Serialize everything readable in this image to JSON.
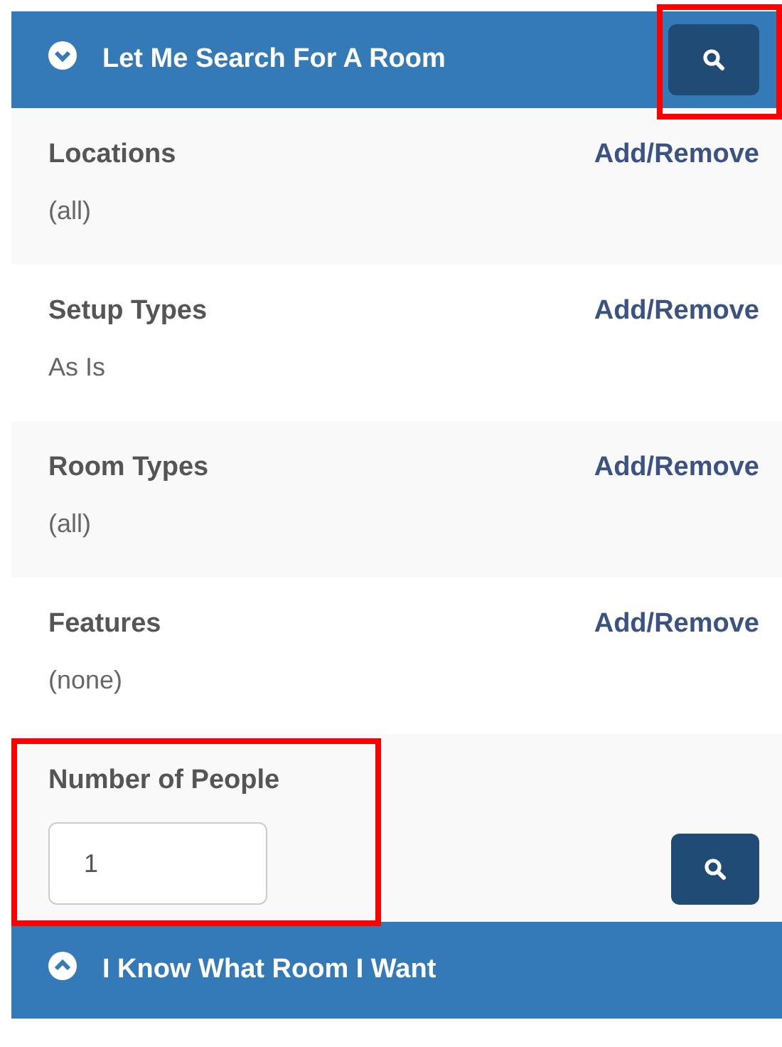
{
  "search_panel": {
    "title": "Let Me Search For A Room",
    "expanded": true,
    "search_button": {
      "highlighted": true
    }
  },
  "filters": [
    {
      "label": "Locations",
      "action": "Add/Remove",
      "value": "(all)"
    },
    {
      "label": "Setup Types",
      "action": "Add/Remove",
      "value": "As Is"
    },
    {
      "label": "Room Types",
      "action": "Add/Remove",
      "value": "(all)"
    },
    {
      "label": "Features",
      "action": "Add/Remove",
      "value": "(none)"
    }
  ],
  "people": {
    "label": "Number of People",
    "value": "1",
    "highlighted": true
  },
  "room_panel": {
    "title": "I Know What Room I Want",
    "expanded": false
  }
}
